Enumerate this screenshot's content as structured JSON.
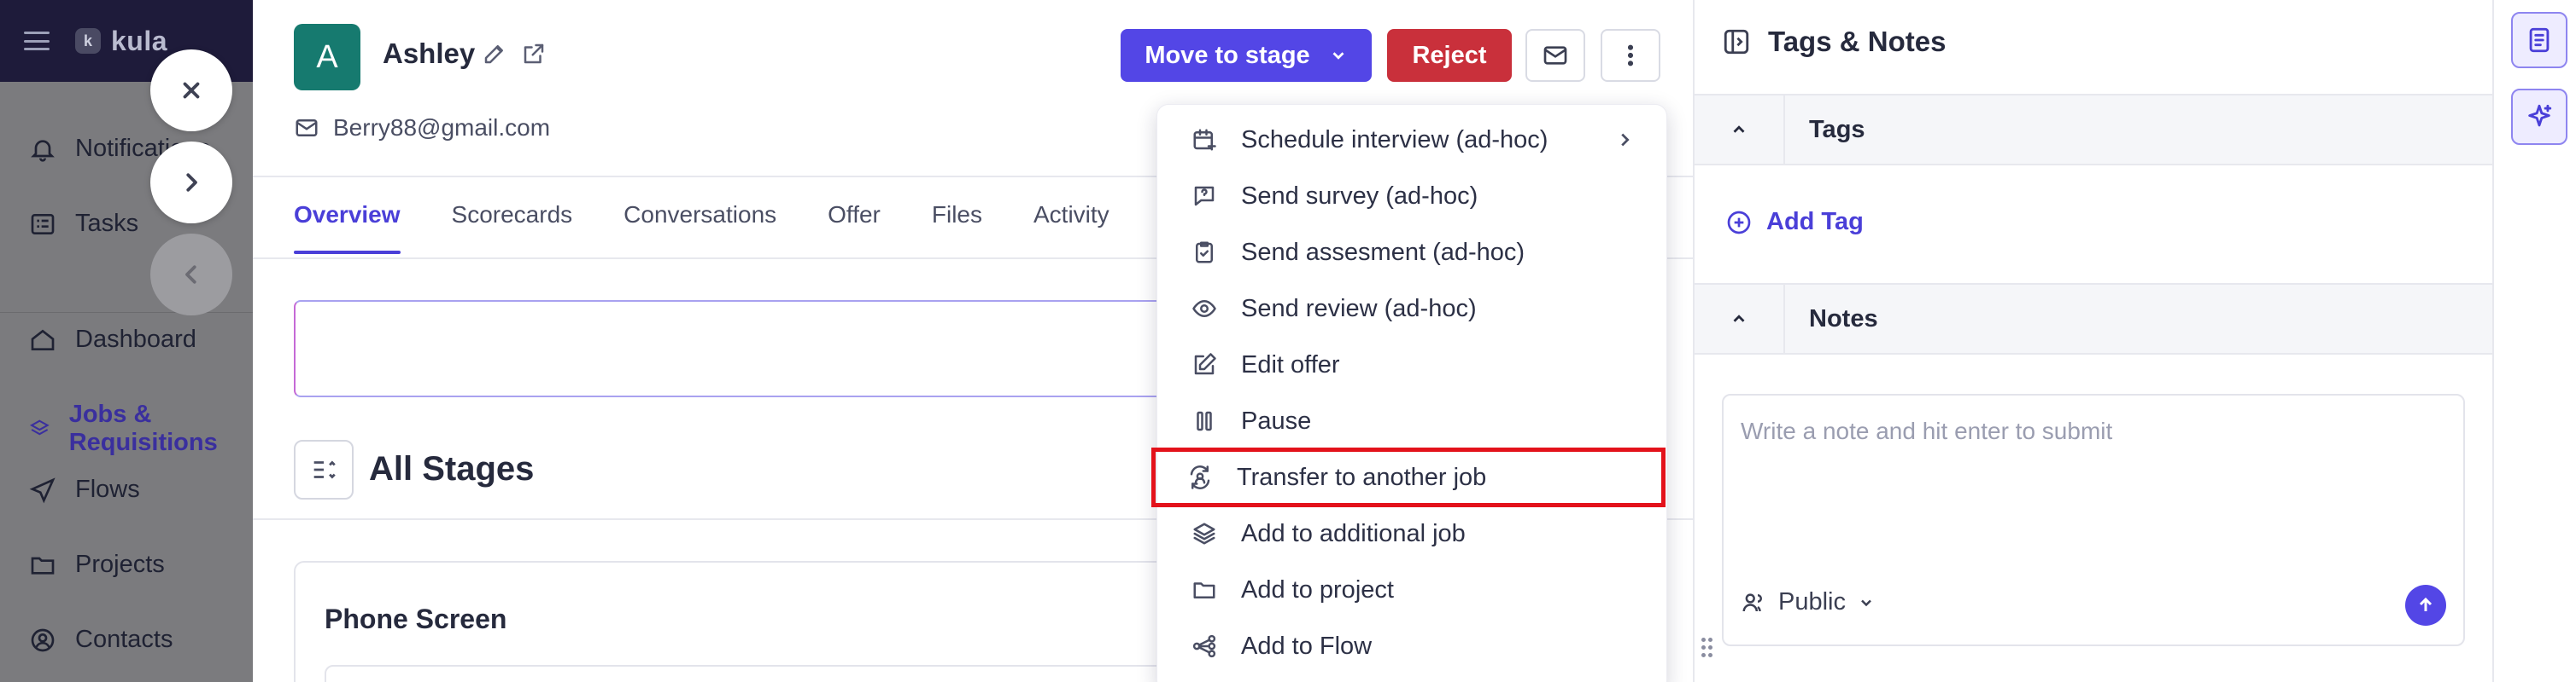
{
  "app": {
    "brand_mark": "k",
    "brand_name": "kula"
  },
  "sidebar": {
    "items": [
      {
        "label": "Notifications",
        "icon": "bell-icon"
      },
      {
        "label": "Tasks",
        "icon": "tasks-icon"
      },
      {
        "label": "Dashboard",
        "icon": "home-icon"
      },
      {
        "label": "Jobs & Requisitions",
        "icon": "layers-icon",
        "active": true
      },
      {
        "label": "Flows",
        "icon": "send-icon"
      },
      {
        "label": "Projects",
        "icon": "folder-icon"
      },
      {
        "label": "Contacts",
        "icon": "contact-icon"
      }
    ]
  },
  "candidate": {
    "initial": "A",
    "name": "Ashley",
    "email": "Berry88@gmail.com"
  },
  "actions": {
    "move_to_stage": "Move to stage",
    "reject": "Reject"
  },
  "tabs": [
    "Overview",
    "Scorecards",
    "Conversations",
    "Offer",
    "Files",
    "Activity"
  ],
  "stages": {
    "title": "All Stages",
    "first_stage": "Phone Screen"
  },
  "menu": {
    "items": [
      {
        "label": "Schedule interview (ad-hoc)",
        "icon": "calendar-plus-icon",
        "has_submenu": true
      },
      {
        "label": "Send survey (ad-hoc)",
        "icon": "message-question-icon"
      },
      {
        "label": "Send assesment (ad-hoc)",
        "icon": "clipboard-check-icon"
      },
      {
        "label": "Send review (ad-hoc)",
        "icon": "eye-icon"
      },
      {
        "label": "Edit offer",
        "icon": "edit-icon"
      },
      {
        "label": "Pause",
        "icon": "pause-icon"
      },
      {
        "label": "Transfer to another job",
        "icon": "user-transfer-icon",
        "highlighted": true
      },
      {
        "label": "Add to additional job",
        "icon": "layers-icon"
      },
      {
        "label": "Add to project",
        "icon": "folder-icon"
      },
      {
        "label": "Add to Flow",
        "icon": "flow-icon"
      }
    ]
  },
  "right_panel": {
    "title": "Tags & Notes",
    "tags_label": "Tags",
    "add_tag": "Add Tag",
    "notes_label": "Notes",
    "note_placeholder": "Write a note and hit enter to submit",
    "visibility": "Public"
  },
  "colors": {
    "primary": "#5346e6",
    "reject": "#c9303b",
    "avatar": "#167a6f",
    "highlight_outline": "#e3121b"
  }
}
